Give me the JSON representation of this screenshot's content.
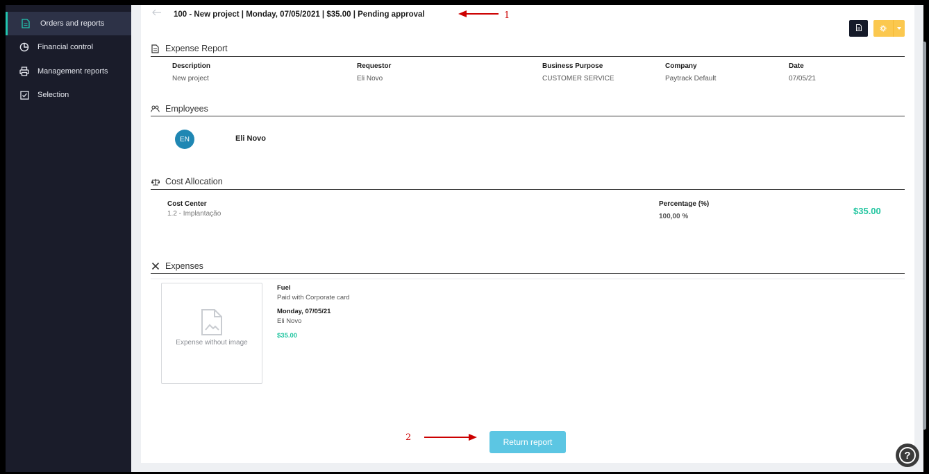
{
  "sidebar": {
    "items": [
      {
        "label": "Orders and reports",
        "icon": "document-icon"
      },
      {
        "label": "Financial control",
        "icon": "pie-chart-icon"
      },
      {
        "label": "Management reports",
        "icon": "printer-icon"
      },
      {
        "label": "Selection",
        "icon": "checkbox-icon"
      }
    ]
  },
  "header": {
    "title": "100 - New project | Monday, 07/05/2021 | $35.00 | Pending approval"
  },
  "expense_report": {
    "section_title": "Expense Report",
    "columns": [
      "Description",
      "Requestor",
      "Business Purpose",
      "Company",
      "Date"
    ],
    "values": [
      "New project",
      "Eli Novo",
      "CUSTOMER SERVICE",
      "Paytrack Default",
      "07/05/21"
    ]
  },
  "employees": {
    "section_title": "Employees",
    "items": [
      {
        "initials": "EN",
        "name": "Eli Novo"
      }
    ]
  },
  "cost_allocation": {
    "section_title": "Cost Allocation",
    "cost_center_label": "Cost Center",
    "cost_center_value": "1.2 - Implantação",
    "percentage_label": "Percentage (%)",
    "percentage_value": "100,00 %",
    "amount": "$35.00"
  },
  "expenses": {
    "section_title": "Expenses",
    "items": [
      {
        "image_placeholder": "Expense without image",
        "category": "Fuel",
        "payment": "Paid with Corporate card",
        "date": "Monday, 07/05/21",
        "person": "Eli Novo",
        "amount": "$35.00"
      }
    ]
  },
  "actions": {
    "return_label": "Return report",
    "help_label": "?"
  },
  "annotations": {
    "one": "1",
    "two": "2"
  },
  "colors": {
    "accent_teal": "#22c5b0",
    "amount_green": "#22c5a0",
    "return_button": "#5cc6e3",
    "settings_button": "#fbc84f",
    "sidebar_bg": "#1a1c2a",
    "annotation_red": "#cc0000"
  }
}
